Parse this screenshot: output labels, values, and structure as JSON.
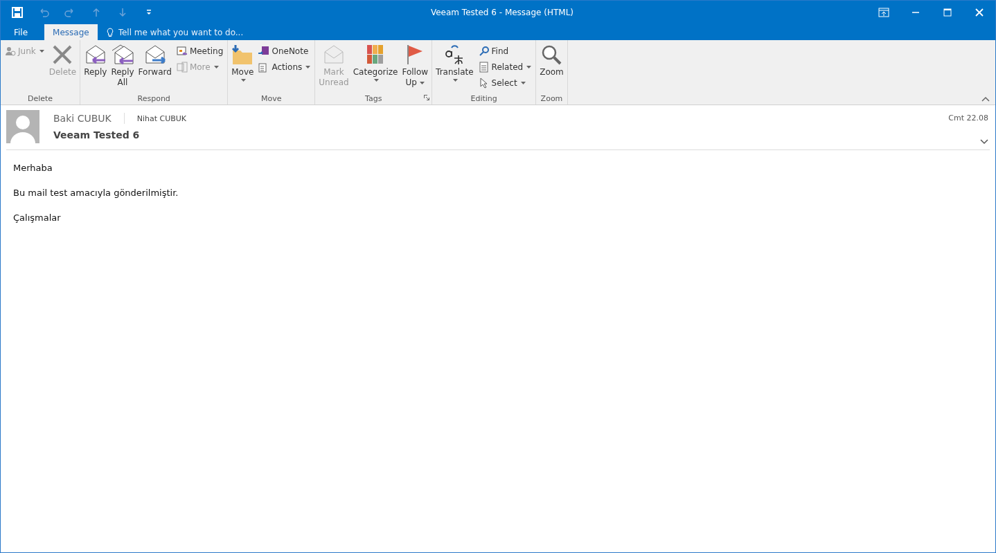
{
  "window": {
    "title": "Veeam Tested 6 - Message (HTML)"
  },
  "quick_access": [
    {
      "kind": "save",
      "disabled": false
    },
    {
      "kind": "undo",
      "disabled": true
    },
    {
      "kind": "redo",
      "disabled": true
    },
    {
      "kind": "up",
      "disabled": true
    },
    {
      "kind": "down",
      "disabled": true
    },
    {
      "kind": "customize",
      "disabled": false
    }
  ],
  "tabs": [
    {
      "label": "File",
      "selected": false
    },
    {
      "label": "Message",
      "selected": true
    }
  ],
  "tell_me": {
    "placeholder": "Tell me what you want to do..."
  },
  "ribbon": {
    "groups": [
      {
        "label": "Delete",
        "launcher": false,
        "items": [
          {
            "kind": "column",
            "items": [
              {
                "label": "Junk",
                "dropdown": true,
                "disabled": true
              }
            ]
          },
          {
            "kind": "large",
            "lines": [
              "Delete"
            ],
            "dropdown": false,
            "disabled": true
          }
        ]
      },
      {
        "label": "Respond",
        "launcher": false,
        "items": [
          {
            "kind": "large",
            "lines": [
              "Reply"
            ],
            "dropdown": false,
            "disabled": false
          },
          {
            "kind": "large",
            "lines": [
              "Reply",
              "All"
            ],
            "dropdown": false,
            "disabled": false
          },
          {
            "kind": "large",
            "lines": [
              "Forward"
            ],
            "dropdown": false,
            "disabled": false
          },
          {
            "kind": "column",
            "items": [
              {
                "label": "Meeting",
                "dropdown": false,
                "disabled": false
              },
              {
                "label": "More",
                "dropdown": true,
                "disabled": true
              }
            ]
          }
        ]
      },
      {
        "label": "Move",
        "launcher": false,
        "items": [
          {
            "kind": "large",
            "lines": [
              "Move"
            ],
            "dropdown": true,
            "disabled": false
          },
          {
            "kind": "column",
            "items": [
              {
                "label": "OneNote",
                "dropdown": false,
                "disabled": false
              },
              {
                "label": "Actions",
                "dropdown": true,
                "disabled": false
              }
            ]
          }
        ]
      },
      {
        "label": "Tags",
        "launcher": true,
        "items": [
          {
            "kind": "large",
            "lines": [
              "Mark",
              "Unread"
            ],
            "dropdown": false,
            "disabled": true
          },
          {
            "kind": "large",
            "lines": [
              "Categorize"
            ],
            "dropdown": true,
            "disabled": false
          },
          {
            "kind": "large",
            "lines": [
              "Follow",
              "Up"
            ],
            "dropdown": true,
            "disabled": false
          }
        ]
      },
      {
        "label": "Editing",
        "launcher": false,
        "items": [
          {
            "kind": "large",
            "lines": [
              "Translate"
            ],
            "dropdown": true,
            "disabled": false
          },
          {
            "kind": "column",
            "items": [
              {
                "label": "Find",
                "dropdown": false,
                "disabled": false
              },
              {
                "label": "Related",
                "dropdown": true,
                "disabled": false
              },
              {
                "label": "Select",
                "dropdown": true,
                "disabled": false
              }
            ]
          }
        ]
      },
      {
        "label": "Zoom",
        "launcher": false,
        "items": [
          {
            "kind": "large",
            "lines": [
              "Zoom"
            ],
            "dropdown": false,
            "disabled": false
          }
        ]
      }
    ]
  },
  "message": {
    "sender": "Baki CUBUK",
    "recipient": "Nihat CUBUK",
    "subject": "Veeam Tested 6",
    "date": "Cmt 22.08",
    "body": [
      "Merhaba",
      "Bu mail test amacıyla gönderilmiştir.",
      "Çalışmalar"
    ]
  }
}
